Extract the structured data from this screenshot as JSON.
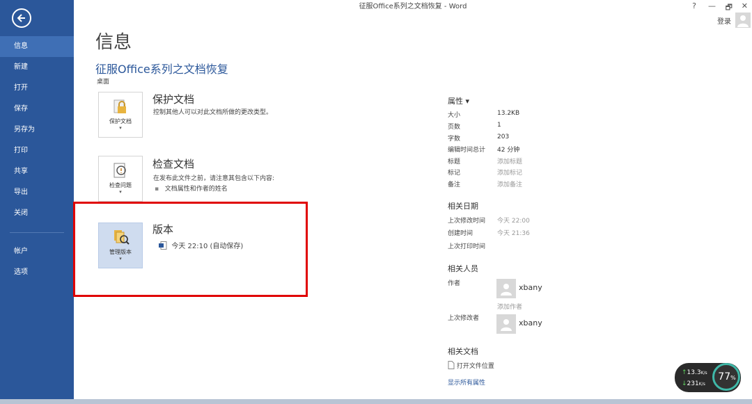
{
  "window": {
    "title": "征服Office系列之文档恢复 - Word",
    "help": "?",
    "minimize": "—",
    "restore": "🗗",
    "close": "✕",
    "login": "登录"
  },
  "sidebar": {
    "back_icon": "back-arrow-icon",
    "items": [
      {
        "label": "信息",
        "active": true
      },
      {
        "label": "新建"
      },
      {
        "label": "打开"
      },
      {
        "label": "保存"
      },
      {
        "label": "另存为"
      },
      {
        "label": "打印"
      },
      {
        "label": "共享"
      },
      {
        "label": "导出"
      },
      {
        "label": "关闭"
      },
      {
        "label": "帐户"
      },
      {
        "label": "选项"
      }
    ]
  },
  "main": {
    "page_title": "信息",
    "doc_title": "征服Office系列之文档恢复",
    "doc_location": "桌面",
    "sections": [
      {
        "tile_label": "保护文档",
        "heading": "保护文档",
        "desc": "控制其他人可以对此文档所做的更改类型。"
      },
      {
        "tile_label": "检查问题",
        "heading": "检查文档",
        "desc": "在发布此文件之前，请注意其包含以下内容:",
        "bullet": "文档属性和作者的姓名"
      },
      {
        "tile_label": "管理版本",
        "heading": "版本",
        "version_entry": "今天 22:10 (自动保存)"
      }
    ]
  },
  "properties": {
    "heading": "属性 ▾",
    "rows": [
      {
        "label": "大小",
        "value": "13.2KB"
      },
      {
        "label": "页数",
        "value": "1"
      },
      {
        "label": "字数",
        "value": "203"
      },
      {
        "label": "编辑时间总计",
        "value": "42 分钟"
      },
      {
        "label": "标题",
        "value": "添加标题"
      },
      {
        "label": "标记",
        "value": "添加标记"
      },
      {
        "label": "备注",
        "value": "添加备注"
      }
    ],
    "dates_heading": "相关日期",
    "dates": [
      {
        "label": "上次修改时间",
        "value": "今天 22:00"
      },
      {
        "label": "创建时间",
        "value": "今天 21:36"
      },
      {
        "label": "上次打印时间",
        "value": ""
      }
    ],
    "people_heading": "相关人员",
    "author_label": "作者",
    "author_name": "xbany",
    "add_author": "添加作者",
    "last_modified_label": "上次修改者",
    "last_modified_name": "xbany",
    "docs_heading": "相关文档",
    "open_location": "打开文件位置",
    "show_all": "显示所有属性"
  },
  "network_widget": {
    "up": "13.3",
    "up_unit": "K/s",
    "down": "231",
    "down_unit": "K/s",
    "percent": "77",
    "percent_unit": "%"
  }
}
